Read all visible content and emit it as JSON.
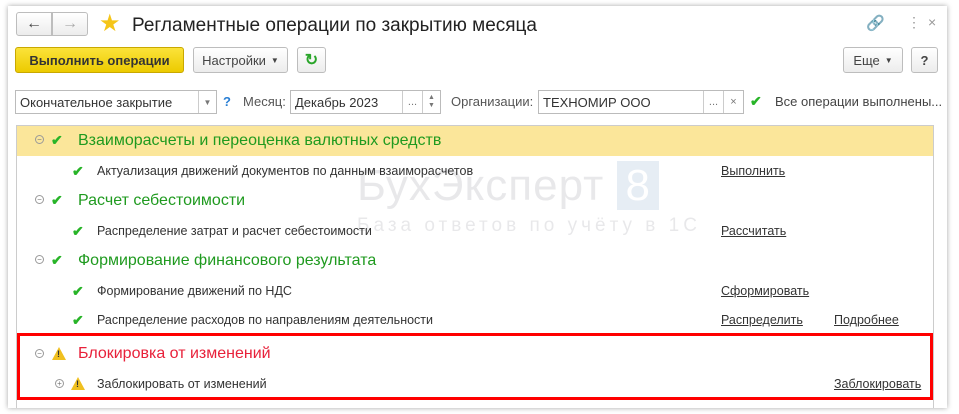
{
  "window": {
    "title": "Регламентные операции по закрытию месяца",
    "icons": [
      "back-icon",
      "forward-icon",
      "star-icon",
      "link-icon",
      "more-icon",
      "close-icon"
    ]
  },
  "toolbar": {
    "run_label": "Выполнить операции",
    "settings_label": "Настройки",
    "more_label": "Еще",
    "help_label": "?"
  },
  "filters": {
    "mode_value": "Окончательное закрытие",
    "help": "?",
    "month_label": "Месяц:",
    "month_value": "Декабрь 2023",
    "org_label": "Организации:",
    "org_value": "ТЕХНОМИР ООО",
    "ellipsis": "...",
    "clear": "×",
    "status": "Все операции выполнены..."
  },
  "watermark": {
    "brand": "БухЭксперт",
    "number": "8",
    "tagline": "База ответов по учёту в 1С"
  },
  "groups": [
    {
      "title": "Взаиморасчеты и переоценка валютных средств",
      "status": "done",
      "items": [
        {
          "label": "Актуализация движений документов по данным взаиморасчетов",
          "action": "Выполнить"
        }
      ]
    },
    {
      "title": "Расчет себестоимости",
      "status": "done",
      "items": [
        {
          "label": "Распределение затрат и расчет себестоимости",
          "action": "Рассчитать"
        }
      ]
    },
    {
      "title": "Формирование финансового результата",
      "status": "done",
      "items": [
        {
          "label": "Формирование движений по НДС",
          "action": "Сформировать"
        },
        {
          "label": "Распределение расходов по направлениям деятельности",
          "action": "Распределить",
          "extra": "Подробнее"
        }
      ]
    },
    {
      "title": "Блокировка от изменений",
      "status": "warning",
      "items": [
        {
          "label": "Заблокировать от изменений",
          "action": "Заблокировать"
        }
      ]
    }
  ],
  "colors": {
    "accent_yellow": "#f5d90a",
    "group_green": "#1f9a1f",
    "warning_red": "#e8213a",
    "highlight_frame": "#ff0000",
    "selected_row": "#fbe69a"
  }
}
